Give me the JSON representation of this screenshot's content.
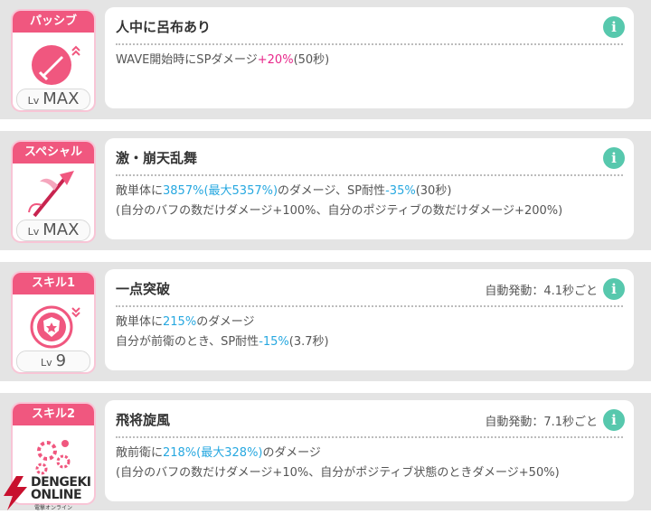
{
  "skills": [
    {
      "tab": "パッシブ",
      "lv_prefix": "Lv",
      "lv": "MAX",
      "icon": "sword-icon",
      "title": "人中に呂布あり",
      "auto": "",
      "lines": [
        [
          {
            "t": "WAVE開始時にSPダメージ"
          },
          {
            "t": "+20%",
            "c": "pink"
          },
          {
            "t": "(50秒)"
          }
        ]
      ]
    },
    {
      "tab": "スペシャル",
      "lv_prefix": "Lv",
      "lv": "MAX",
      "icon": "halberd-icon",
      "title": "激・崩天乱舞",
      "auto": "",
      "lines": [
        [
          {
            "t": "敵単体に"
          },
          {
            "t": "3857%(最大5357%)",
            "c": "blue"
          },
          {
            "t": "のダメージ、SP耐性"
          },
          {
            "t": "-35%",
            "c": "blue"
          },
          {
            "t": "(30秒)"
          }
        ],
        [
          {
            "t": "(自分のバフの数だけダメージ+100%、自分のポジティブの数だけダメージ+200%)"
          }
        ]
      ]
    },
    {
      "tab": "スキル1",
      "lv_prefix": "Lv",
      "lv": "9",
      "icon": "shield-icon",
      "title": "一点突破",
      "auto": "自動発動：4.1秒ごと",
      "lines": [
        [
          {
            "t": "敵単体に"
          },
          {
            "t": "215%",
            "c": "blue"
          },
          {
            "t": "のダメージ"
          }
        ],
        [
          {
            "t": "自分が前衛のとき、SP耐性"
          },
          {
            "t": "-15%",
            "c": "blue"
          },
          {
            "t": "(3.7秒)"
          }
        ]
      ]
    },
    {
      "tab": "スキル2",
      "lv_prefix": "",
      "lv": "",
      "icon": "burst-icon",
      "title": "飛将旋風",
      "auto": "自動発動：7.1秒ごと",
      "lines": [
        [
          {
            "t": "敵前衛に"
          },
          {
            "t": "218%(最大328%)",
            "c": "blue"
          },
          {
            "t": "のダメージ"
          }
        ],
        [
          {
            "t": "(自分のバフの数だけダメージ+10%、自分がポジティブ状態のときダメージ+50%)"
          }
        ]
      ]
    }
  ],
  "info_glyph": "i",
  "watermark": {
    "line1": "DENGEKI",
    "line2": "ONLINE",
    "line3": "電撃オンライン"
  },
  "colors": {
    "accent": "#f0577f",
    "highlight_pink": "#e8268a",
    "highlight_blue": "#27a8e0",
    "info": "#57c8ad"
  }
}
